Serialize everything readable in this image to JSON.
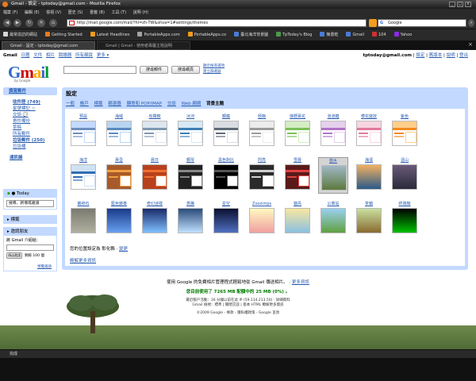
{
  "window": {
    "title": "Gmail - 設定 - tptoday@gmail.com - Mozilla Firefox"
  },
  "menubar": [
    "檔案 (F)",
    "編輯 (E)",
    "檢視 (V)",
    "歷史 (S)",
    "書籤 (B)",
    "工具 (T)",
    "說明 (H)"
  ],
  "navbar": {
    "url": "http://mail.google.com/mail/?hl=zh-TW&shva=1#settings/themes",
    "search_value": "Google"
  },
  "bookmarks": [
    {
      "label": "最常造訪的網站",
      "color": "#d8d8d8"
    },
    {
      "label": "Getting Started",
      "color": "#e8791f"
    },
    {
      "label": "Latest Headlines",
      "color": "#f39c1e"
    },
    {
      "label": "PortableApps.com",
      "color": "#a3a3a3"
    },
    {
      "label": "PortableApps.co",
      "color": "#f39c1e"
    },
    {
      "label": "臺北海洋背景圖",
      "color": "#4a7bd6"
    },
    {
      "label": "TpToday's Blog",
      "color": "#4a9b4a"
    },
    {
      "label": "簡書乾",
      "color": "#4a7bd6"
    },
    {
      "label": "Gmail",
      "color": "#4a7bd6"
    },
    {
      "label": "104",
      "color": "#d03030"
    },
    {
      "label": "Yahoo",
      "color": "#8a2be2"
    }
  ],
  "tabs": [
    {
      "label": "Gmail - 設定 - tptoday@gmail.com",
      "active": true
    },
    {
      "label": "Gmail | Gmail - 使用者專屬主題說明",
      "active": false
    }
  ],
  "gmail": {
    "top_links": [
      "Gmail",
      "日曆",
      "文件",
      "相片",
      "閱讀器",
      "所有網頁",
      "更多 ▾"
    ],
    "user_links": [
      "tptoday@gmail.com",
      "設定",
      "舊版本",
      "說明",
      "登出"
    ],
    "logo_text": "Gmail",
    "logo_sub": "by Google",
    "search_mail": "搜尋郵件",
    "search_web": "搜尋網頁",
    "search_options": "顯示搜尋選項",
    "create_filter": "建立篩選器",
    "compose": "撰寫郵件",
    "nav": [
      "收件匣 (749)",
      "星號標記 ☆",
      "交談 💬",
      "寄件備份",
      "草稿",
      "所有郵件",
      "垃圾郵件 (250)",
      "垃圾桶"
    ],
    "nav_contacts": "通訊錄",
    "chat_header": "● Today",
    "chat_input": "搜尋、新增或邀請",
    "labels_header": "標籤",
    "invite_header": "邀請朋友",
    "invite_text": "將 Gmail 介紹給：",
    "invite_button": "傳送邀請",
    "invite_left": "剩餘 100 個",
    "invite_preview": "預覽邀請",
    "settings_title": "設定",
    "settings_tabs": [
      "一般",
      "帳戶",
      "標籤",
      "篩選器",
      "轉寄和 POP/IMAP",
      "交談",
      "Web 網摘",
      "背景主題"
    ],
    "themes": [
      {
        "name": "預設",
        "kind": "light",
        "top": "#c3d9ff",
        "accent": "#6f8fc0"
      },
      {
        "name": "海域",
        "kind": "light",
        "top": "#b8d4f0",
        "accent": "#5a8ac0"
      },
      {
        "name": "有霧鏡",
        "kind": "light",
        "top": "#dde6ef",
        "accent": "#7f98b2"
      },
      {
        "name": "冰河",
        "kind": "light",
        "top": "#d6e9f5",
        "accent": "#3e7fb5"
      },
      {
        "name": "鋼鐵",
        "kind": "light",
        "top": "#d9dde3",
        "accent": "#5e6a78"
      },
      {
        "name": "極簡",
        "kind": "light",
        "top": "#ececec",
        "accent": "#9a9a9a"
      },
      {
        "name": "綠野黃花",
        "kind": "light",
        "top": "#d4edc4",
        "accent": "#7ac058"
      },
      {
        "name": "泡泡糖",
        "kind": "light",
        "top": "#e6d0ec",
        "accent": "#b074c8"
      },
      {
        "name": "櫻花盛放",
        "kind": "light",
        "top": "#f6d6e0",
        "accent": "#e07a9a"
      },
      {
        "name": "紫色",
        "kind": "light",
        "top": "#ffcf8a",
        "accent": "#f28a1e"
      },
      {
        "name": "海洋",
        "kind": "light",
        "top": "#cfe2f3",
        "accent": "#2f6db5"
      },
      {
        "name": "黃昏",
        "kind": "dark",
        "top": "#a85a2a",
        "accent": "#f0a040"
      },
      {
        "name": "晨日",
        "kind": "dark",
        "top": "#b8401c",
        "accent": "#f07030"
      },
      {
        "name": "鋼琴",
        "kind": "dark",
        "top": "#222222",
        "accent": "#888888"
      },
      {
        "name": "黑色對比",
        "kind": "dark",
        "top": "#000000",
        "accent": "#555555"
      },
      {
        "name": "閃亮",
        "kind": "dark",
        "top": "#2a2a2a",
        "accent": "#d0d0d0"
      },
      {
        "name": "雪晨",
        "kind": "dark",
        "top": "#5a1a1a",
        "accent": "#e04040"
      },
      {
        "name": "樹木",
        "kind": "photo",
        "top": "#9fb8c8",
        "accent": "#5d7a3c"
      },
      {
        "name": "海濱",
        "kind": "photo",
        "top": "#f0b060",
        "accent": "#2a5a8a"
      },
      {
        "name": "遠山",
        "kind": "photo",
        "top": "#6a5a7a",
        "accent": "#2a2a3a"
      },
      {
        "name": "鵝卵石",
        "kind": "photo",
        "top": "#7a7a70",
        "accent": "#b0b0a0"
      },
      {
        "name": "藍色變奏",
        "kind": "photo",
        "top": "#1a3a8a",
        "accent": "#6aa0f0"
      },
      {
        "name": "奇幻迷樣",
        "kind": "photo",
        "top": "#1a2a6a",
        "accent": "#80c0ff"
      },
      {
        "name": "蒸騰",
        "kind": "photo",
        "top": "#2a4a7a",
        "accent": "#c0e0ff"
      },
      {
        "name": "星空",
        "kind": "photo",
        "top": "#0a1030",
        "accent": "#5070c0"
      },
      {
        "name": "Zoozimps",
        "kind": "photo",
        "top": "#fff8c0",
        "accent": "#f0a0a0"
      },
      {
        "name": "貓鳥",
        "kind": "photo",
        "top": "#f8e8a0",
        "accent": "#8ac0e0"
      },
      {
        "name": "公車站",
        "kind": "photo",
        "top": "#9ad0f0",
        "accent": "#60a040"
      },
      {
        "name": "茶鎮",
        "kind": "photo",
        "top": "#c8e0a0",
        "accent": "#8a6a30"
      },
      {
        "name": "終端機",
        "kind": "photo",
        "top": "#000000",
        "accent": "#00c000"
      }
    ],
    "selected_theme": "樹木",
    "location_note": "您的位置設定為 彰化縣 ·",
    "location_change": "變更",
    "more_themes": "瞭解更多資訊",
    "footer_tip": "使用 Google 的免費相片管理程式輕鬆地從 Gmail 傳送相片。",
    "footer_tip_link": "更多資訊",
    "footer_usage": "您目前使用了 7265 MB 配額中的 25 MB (0%) 。",
    "footer_activity": "最近帳戶活動：16 分鐘以前在此 IP (59.114.213.50) · 詳細資料",
    "footer_view": "Gmail 檢視：標準 | 關閉交談 | 基本 HTML 瞭解更多資訊",
    "footer_copy": "©2009 Google - 條款 - 隱私權政策 - Google 首頁"
  },
  "status": {
    "text": "完成"
  }
}
